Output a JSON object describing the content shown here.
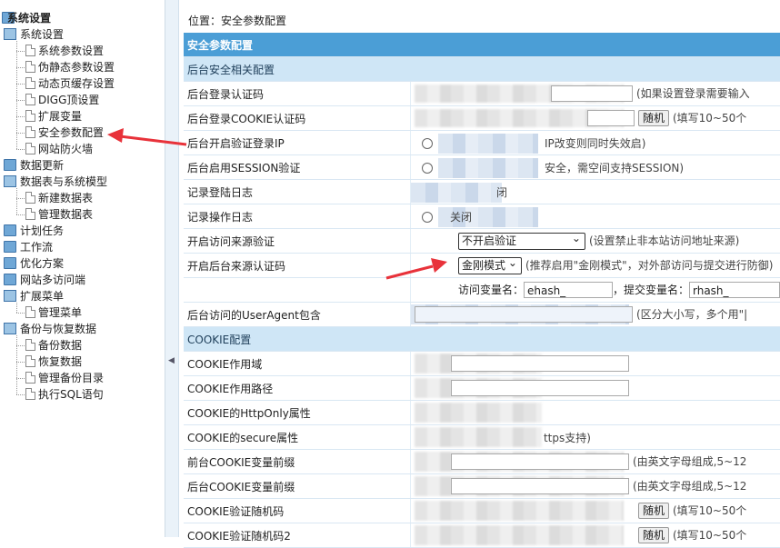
{
  "sidebar": {
    "root": "系统设置",
    "groups": [
      {
        "label": "系统设置",
        "children": [
          "系统参数设置",
          "伪静态参数设置",
          "动态页缓存设置",
          "DIGG顶设置",
          "扩展变量",
          "安全参数配置",
          "网站防火墙"
        ]
      },
      {
        "label": "数据更新",
        "children": []
      },
      {
        "label": "数据表与系统模型",
        "children": [
          "新建数据表",
          "管理数据表"
        ]
      },
      {
        "label": "计划任务",
        "children": []
      },
      {
        "label": "工作流",
        "children": []
      },
      {
        "label": "优化方案",
        "children": []
      },
      {
        "label": "网站多访问端",
        "children": []
      },
      {
        "label": "扩展菜单",
        "children": [
          "管理菜单"
        ]
      },
      {
        "label": "备份与恢复数据",
        "children": [
          "备份数据",
          "恢复数据",
          "管理备份目录",
          "执行SQL语句"
        ]
      }
    ]
  },
  "splitter_arrow": "◀",
  "breadcrumb": "位置：安全参数配置",
  "form": {
    "header": "安全参数配置",
    "section1": "后台安全相关配置",
    "rows1": [
      {
        "label": "后台登录认证码",
        "hint": "(如果设置登录需要输入"
      },
      {
        "label": "后台登录COOKIE认证码",
        "btn": "随机",
        "hint": "(填写10~50个"
      },
      {
        "label": "后台开启验证登录IP",
        "hint": "IP改变则同时失效启)"
      },
      {
        "label": "后台启用SESSION验证",
        "hint": "安全，需空间支持SESSION)"
      },
      {
        "label": "记录登陆日志",
        "hint": "闭"
      },
      {
        "label": "记录操作日志",
        "hint": "关闭"
      },
      {
        "label": "开启访问来源验证",
        "select": "不开启验证",
        "hint": "(设置禁止非本站访问地址来源)"
      },
      {
        "label": "开启后台来源认证码",
        "select": "金刚模式",
        "hint": "(推荐启用\"金刚模式\"，对外部访问与提交进行防御)"
      },
      {
        "label": "",
        "var_label": "访问变量名：",
        "var_value": "ehash_",
        "sub_label": "，提交变量名：",
        "sub_value": "rhash_"
      },
      {
        "label": "后台访问的UserAgent包含",
        "hint": "(区分大小写，多个用\"|"
      }
    ],
    "section2": "COOKIE配置",
    "rows2": [
      {
        "label": "COOKIE作用域",
        "hint": ""
      },
      {
        "label": "COOKIE作用路径",
        "hint": ""
      },
      {
        "label": "COOKIE的HttpOnly属性",
        "hint": ""
      },
      {
        "label": "COOKIE的secure属性",
        "hint": "ttps支持)"
      },
      {
        "label": "前台COOKIE变量前缀",
        "hint": "(由英文字母组成,5~12"
      },
      {
        "label": "后台COOKIE变量前缀",
        "hint": "(由英文字母组成,5~12"
      },
      {
        "label": "COOKIE验证随机码",
        "btn": "随机",
        "hint": "(填写10~50个"
      },
      {
        "label": "COOKIE验证随机码2",
        "btn": "随机",
        "hint": "(填写10~50个"
      }
    ]
  },
  "colors": {
    "header_bg": "#4b9ed6",
    "sub_bg": "#cfe6f6",
    "arrow": "#e8323a"
  }
}
